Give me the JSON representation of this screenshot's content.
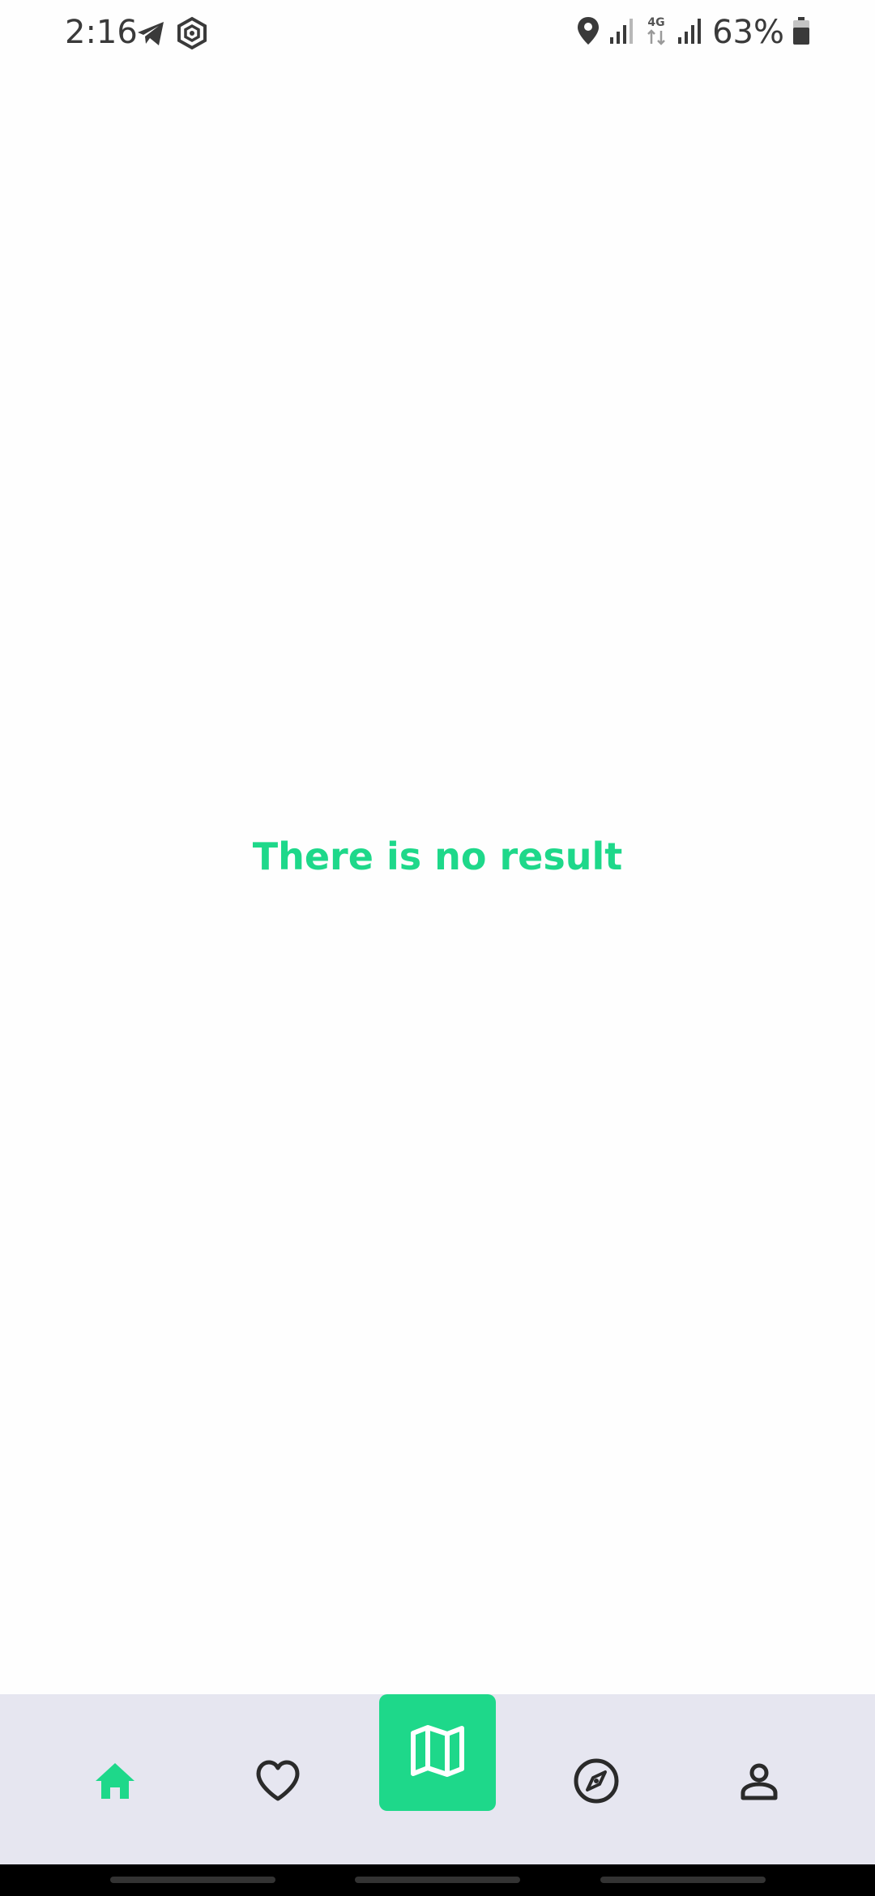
{
  "status_bar": {
    "time": "2:16",
    "battery": "63%",
    "network": "4G",
    "icons": [
      "telegram-icon",
      "vpn-shield-icon",
      "location-icon",
      "signal-icon",
      "signal-icon",
      "battery-icon"
    ]
  },
  "main": {
    "empty_message": "There is no result"
  },
  "bottom_nav": {
    "items": [
      "home-icon",
      "heart-icon",
      "map-icon",
      "compass-icon",
      "profile-icon"
    ],
    "active": "home",
    "accent_color": "#1ed88a",
    "background_color": "#e6e6f0"
  }
}
